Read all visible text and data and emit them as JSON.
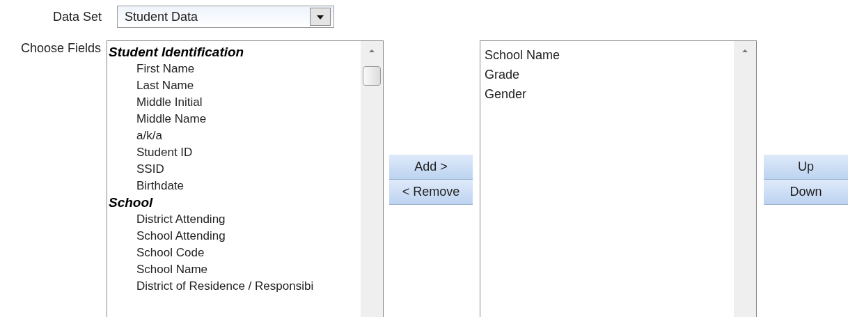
{
  "data_set": {
    "label": "Data Set",
    "value": "Student Data"
  },
  "choose_fields": {
    "label": "Choose Fields",
    "groups": [
      {
        "title": "Student Identification",
        "children": [
          {
            "label": "First Name"
          },
          {
            "label": "Last Name"
          },
          {
            "label": "Middle Initial"
          },
          {
            "label": "Middle Name"
          },
          {
            "label": "a/k/a"
          },
          {
            "label": "Student ID"
          },
          {
            "label": "SSID"
          },
          {
            "label": "Birthdate"
          }
        ]
      },
      {
        "title": "School",
        "children": [
          {
            "label": "District Attending"
          },
          {
            "label": "School Attending"
          },
          {
            "label": "School Code"
          },
          {
            "label": "School Name"
          },
          {
            "label": "District of Residence / Responsibi"
          }
        ]
      }
    ]
  },
  "transfer_buttons": [
    "Add >",
    "< Remove"
  ],
  "selected_fields": [
    "School Name",
    "Grade",
    "Gender"
  ],
  "order_buttons": [
    "Up",
    "Down"
  ]
}
